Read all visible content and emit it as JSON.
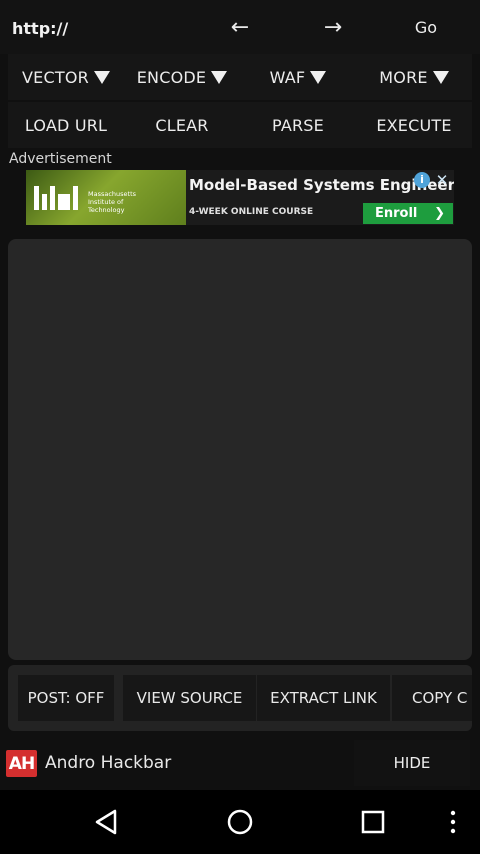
{
  "url_bar": {
    "url_value": "http://",
    "back_glyph": "←",
    "forward_glyph": "→",
    "go_label": "Go"
  },
  "menus": [
    {
      "label": "VECTOR"
    },
    {
      "label": "ENCODE"
    },
    {
      "label": "WAF"
    },
    {
      "label": "MORE"
    }
  ],
  "actions": [
    {
      "label": "LOAD URL"
    },
    {
      "label": "CLEAR"
    },
    {
      "label": "PARSE"
    },
    {
      "label": "EXECUTE"
    }
  ],
  "ad": {
    "label": "Advertisement",
    "institution": "Massachusetts Institute of Technology",
    "title": "Model-Based Systems Engineering",
    "subtitle": "4-WEEK ONLINE COURSE",
    "cta": "Enroll",
    "info_icon": "info-icon",
    "close_icon": "close-icon",
    "accent_green": "#1e9d3e",
    "info_blue": "#4fa3d9"
  },
  "editor": {
    "value": ""
  },
  "bottom_actions": {
    "post": "POST: OFF",
    "view_source": "VIEW SOURCE",
    "extract_link": "EXTRACT LINK",
    "copy": "COPY C"
  },
  "footer": {
    "logo_text": "AH",
    "app_name": "Andro Hackbar",
    "hide_label": "HIDE",
    "logo_color": "#d42f2f"
  },
  "system_nav": {
    "back_icon": "nav-back-icon",
    "home_icon": "nav-home-icon",
    "recents_icon": "nav-recents-icon",
    "more_icon": "overflow-menu-icon"
  }
}
